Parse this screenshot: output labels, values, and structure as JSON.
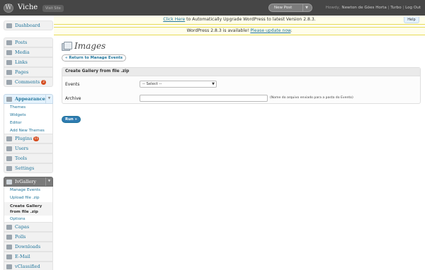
{
  "header": {
    "logo_letter": "W",
    "site_title": "Viche",
    "visit_site_label": "Visit Site",
    "new_post_label": "New Post",
    "howdy_prefix": "Howdy,",
    "user_name": "Newton de Góes Horta",
    "turbo_label": "Turbo",
    "logout_label": "Log Out",
    "separator": "|"
  },
  "notices": {
    "upgrade_link": "Click Here",
    "upgrade_text": " to Automatically Upgrade WordPress to latest Version 2.8.3.",
    "available_text": "WordPress 2.8.3 is available! ",
    "update_link": "Please update now",
    "update_end": ".",
    "help_label": "Help"
  },
  "sidebar": {
    "dashboard": "Dashboard",
    "posts": "Posts",
    "media": "Media",
    "links": "Links",
    "pages": "Pages",
    "comments": "Comments",
    "comments_badge": "2",
    "appearance": "Appearance",
    "appearance_sub": [
      "Themes",
      "Widgets",
      "Editor",
      "Add New Themes"
    ],
    "plugins": "Plugins",
    "plugins_badge": "11",
    "users": "Users",
    "tools": "Tools",
    "settings": "Settings",
    "ivgallery": "IvGallery",
    "ivgallery_sub": [
      "Manage Events",
      "Upload file .zip",
      "Create Gallery from file .zip",
      "Options"
    ],
    "capas": "Capas",
    "polls": "Polls",
    "downloads": "Downloads",
    "email": "E-Mail",
    "vclassified": "vClassified"
  },
  "main": {
    "page_title": "Images",
    "return_button": "« Return to Manage Events",
    "form_title": "Create Gallery from file .zip",
    "events_label": "Events",
    "events_selected": "-- Select --",
    "archive_label": "Archive",
    "archive_hint": "(Nome do arquivo enviado para a pasta do Evento)",
    "run_button": "Run »"
  },
  "colors": {
    "header_bg": "#464646",
    "link": "#21759b",
    "notice_bg": "#fffeeb",
    "badge": "#d54e21",
    "button_primary": "#2e7bb1"
  }
}
